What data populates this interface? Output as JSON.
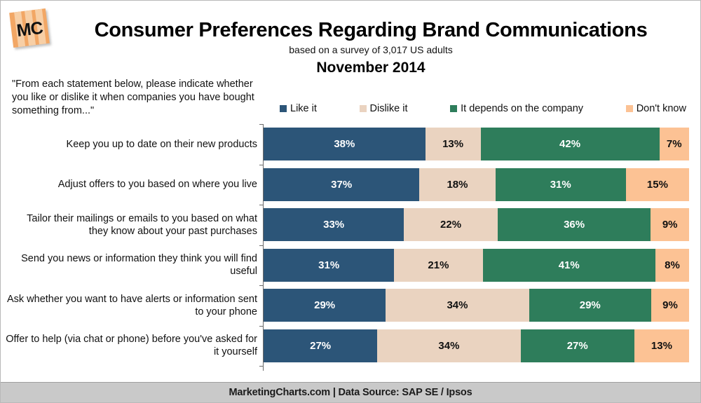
{
  "logo": {
    "text": "MC",
    "tile_color": "#F2A765",
    "stripe_color": "#F7CFA6"
  },
  "header": {
    "title": "Consumer Preferences Regarding Brand Communications",
    "subtitle": "based on a survey of 3,017 US adults",
    "period": "November 2014"
  },
  "question": "\"From each statement below, please indicate whether you like or dislike it when companies you have bought something from...\"",
  "footer": {
    "text": "MarketingCharts.com | Data Source: SAP SE / Ipsos",
    "background": "#C9C9C9"
  },
  "chart_data": {
    "type": "bar",
    "orientation": "horizontal",
    "stacked": true,
    "stack_total": 100,
    "unit": "%",
    "title": "Consumer Preferences Regarding Brand Communications",
    "subtitle": "based on a survey of 3,017 US adults",
    "xlabel": "",
    "ylabel": "",
    "xlim": [
      0,
      100
    ],
    "grid": false,
    "legend_position": "top",
    "categories": [
      "Keep you up to date on their new products",
      "Adjust offers to you based on where you live",
      "Tailor their mailings or emails to you based on what they know about your past purchases",
      "Send you news or information they think you will find useful",
      "Ask whether you want to have alerts or information sent to your phone",
      "Offer to help (via chat or phone) before you've asked for it yourself"
    ],
    "series": [
      {
        "name": "Like it",
        "color": "#2C5578",
        "label_color": "#FFFFFF",
        "values": [
          38,
          37,
          33,
          31,
          29,
          27
        ],
        "labels": [
          "38%",
          "37%",
          "33%",
          "31%",
          "29%",
          "27%"
        ]
      },
      {
        "name": "Dislike it",
        "color": "#EAD3C0",
        "label_color": "#111111",
        "values": [
          13,
          18,
          22,
          21,
          34,
          34
        ],
        "labels": [
          "13%",
          "18%",
          "22%",
          "21%",
          "34%",
          "34%"
        ]
      },
      {
        "name": "It depends on the company",
        "color": "#2E7D5B",
        "label_color": "#FFFFFF",
        "values": [
          42,
          31,
          36,
          41,
          29,
          27
        ],
        "labels": [
          "42%",
          "31%",
          "36%",
          "41%",
          "29%",
          "27%"
        ]
      },
      {
        "name": "Don't know",
        "color": "#FCC294",
        "label_color": "#111111",
        "values": [
          7,
          15,
          9,
          8,
          9,
          13
        ],
        "labels": [
          "7%",
          "15%",
          "9%",
          "8%",
          "9%",
          "13%"
        ]
      }
    ]
  }
}
